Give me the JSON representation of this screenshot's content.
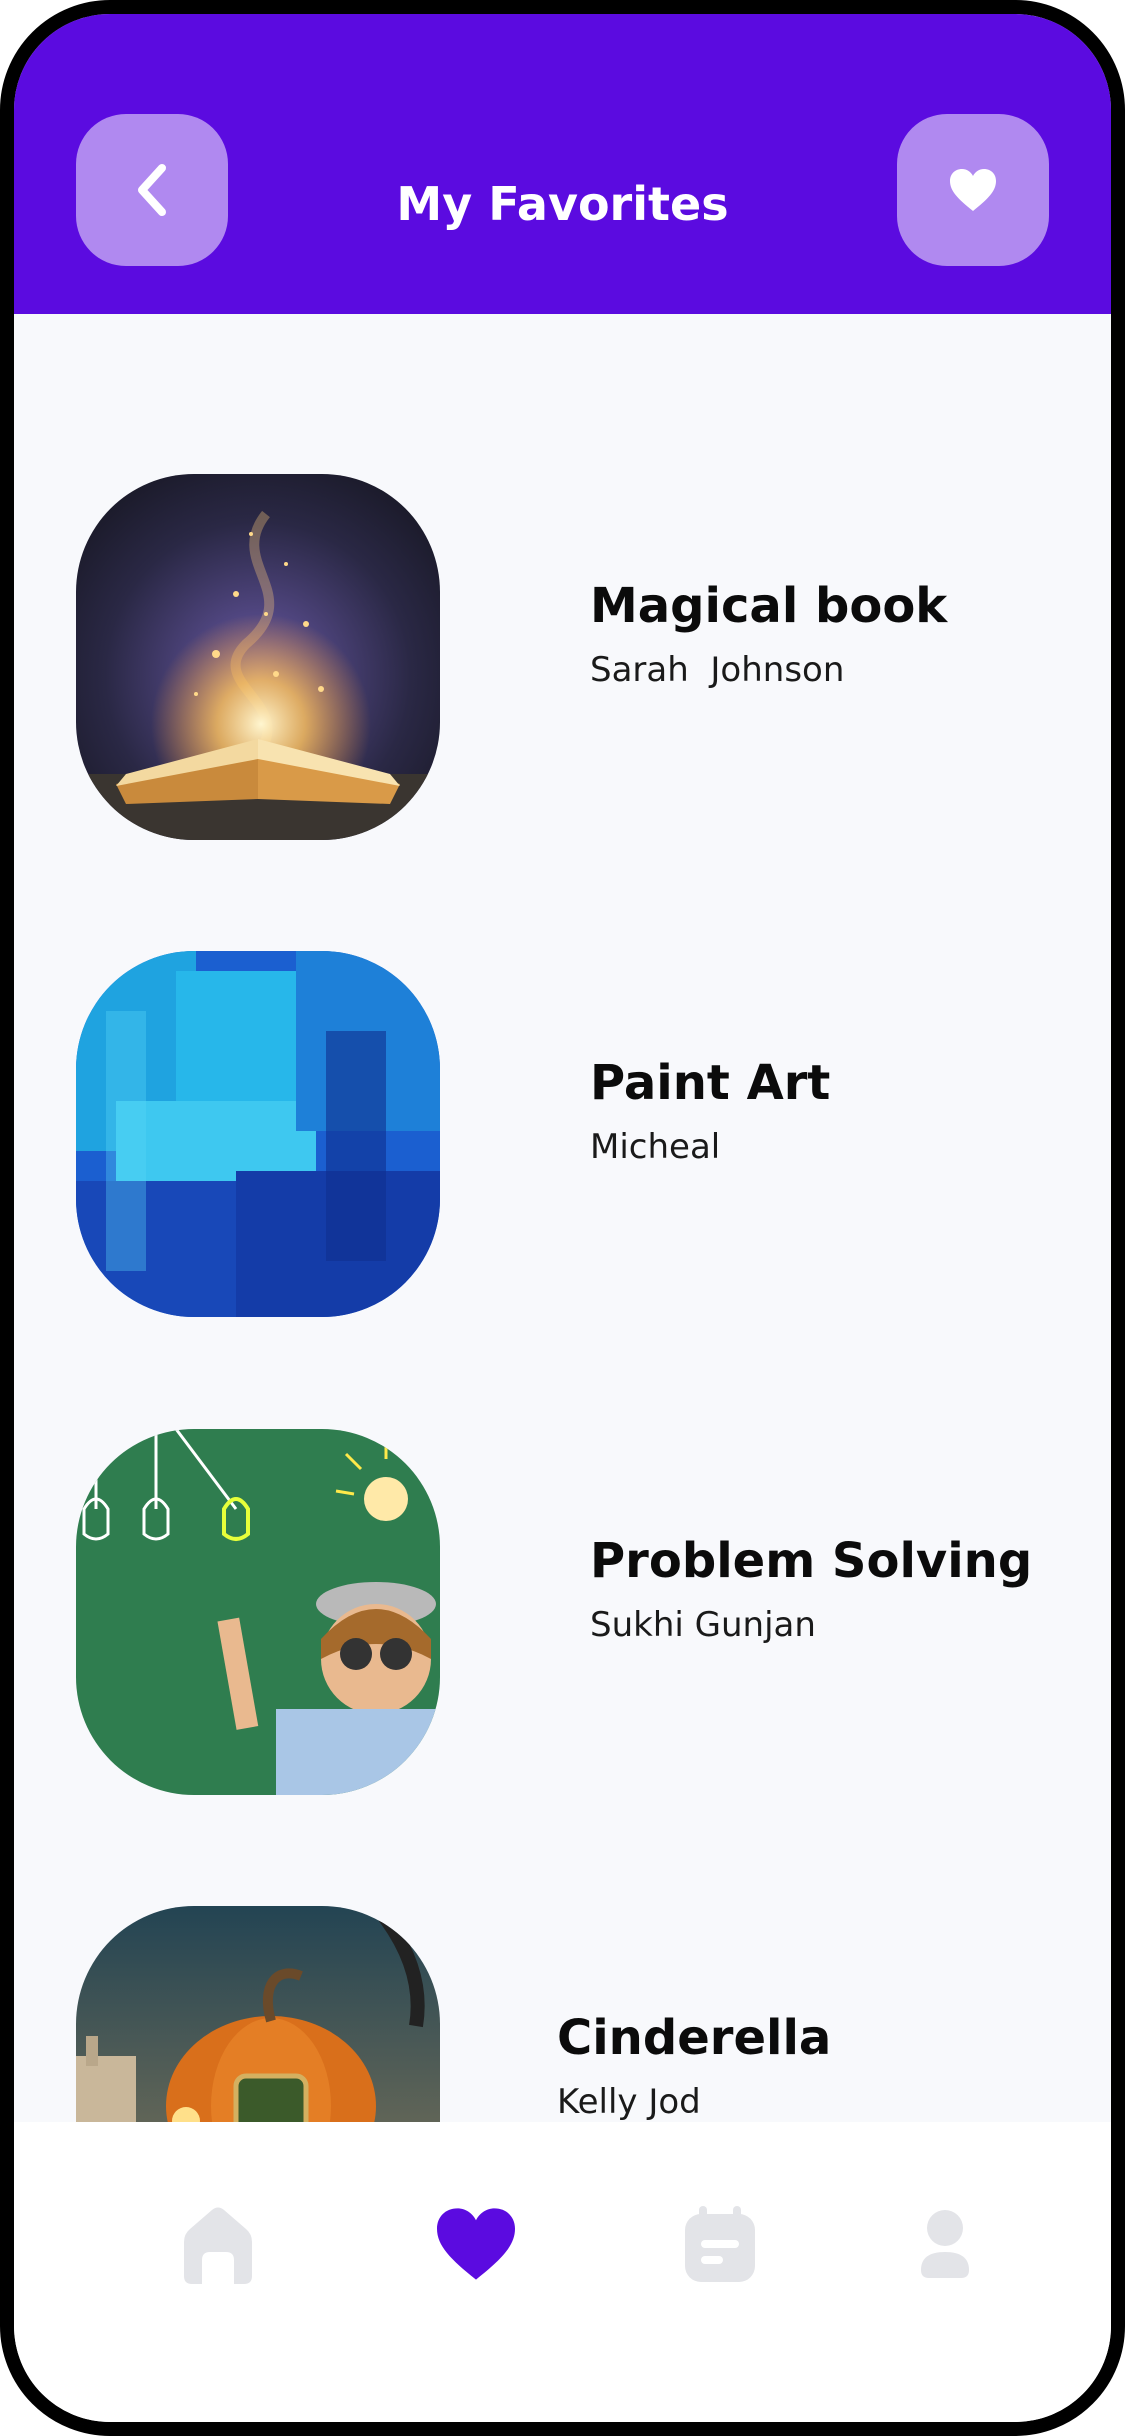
{
  "header": {
    "title": "My Favorites",
    "back_icon": "chevron-left-icon",
    "favorite_icon": "heart-icon",
    "background": "#5b0be0",
    "button_color": "#b089f0"
  },
  "favorites": [
    {
      "title": "Magical book",
      "author": "Sarah  Johnson",
      "image": "magical-book-image"
    },
    {
      "title": "Paint Art",
      "author": "Micheal",
      "image": "blue-paint-image"
    },
    {
      "title": "Problem Solving",
      "author": "Sukhi Gunjan",
      "image": "lightbulb-kid-image"
    },
    {
      "title": "Cinderella",
      "author": "Kelly Jod",
      "image": "pumpkin-carriage-image"
    }
  ],
  "bottom_nav": {
    "items": [
      {
        "icon": "home-icon",
        "active": false
      },
      {
        "icon": "heart-icon",
        "active": true
      },
      {
        "icon": "calendar-icon",
        "active": false
      },
      {
        "icon": "profile-icon",
        "active": false
      }
    ],
    "active_color": "#5b0be0",
    "inactive_color": "#e3e4e8"
  }
}
